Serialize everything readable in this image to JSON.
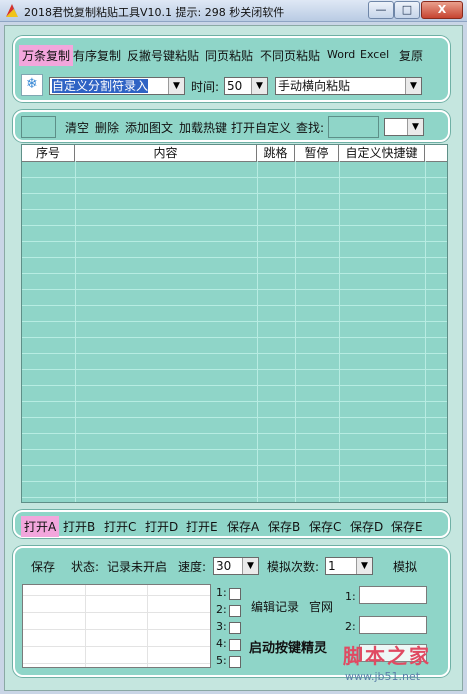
{
  "window": {
    "title": "2018君悦复制粘贴工具V10.1 提示: 298 秒关闭软件",
    "min_label": "—",
    "max_label": "□",
    "close_label": "X"
  },
  "top_tabs": [
    "万条复制",
    "有序复制",
    "反撇号键粘贴",
    "同页粘贴",
    "不同页粘贴",
    "Word",
    "Excel",
    "复原"
  ],
  "mode_select": "自定义分割符录入",
  "time_label": "时间:",
  "time_select": "50",
  "paste_select": "手动横向粘贴",
  "toolbar": {
    "clear": "清空",
    "delete": "删除",
    "add_image": "添加图文",
    "load_hotkey": "加载热键",
    "open_custom": "打开自定义",
    "find_label": "查找:"
  },
  "table_headers": [
    "序号",
    "内容",
    "跳格",
    "暂停",
    "自定义快捷键"
  ],
  "open_buttons": [
    "打开A",
    "打开B",
    "打开C",
    "打开D",
    "打开E"
  ],
  "save_buttons": [
    "保存A",
    "保存B",
    "保存C",
    "保存D",
    "保存E"
  ],
  "bottom": {
    "save": "保存",
    "status_label": "状态:",
    "status_value": "记录未开启",
    "speed_label": "速度:",
    "speed_value": "30",
    "sim_count_label": "模拟次数:",
    "sim_count_value": "1",
    "simulate": "模拟",
    "edit_record": "编辑记录",
    "official_site": "官网",
    "start_wizard": "启动按键精灵",
    "check_labels": [
      "1:",
      "2:",
      "3:",
      "4:",
      "5:"
    ],
    "right_labels": [
      "1:",
      "2:"
    ]
  },
  "watermark": {
    "text": "脚本之家",
    "url": "www.jb51.net"
  }
}
